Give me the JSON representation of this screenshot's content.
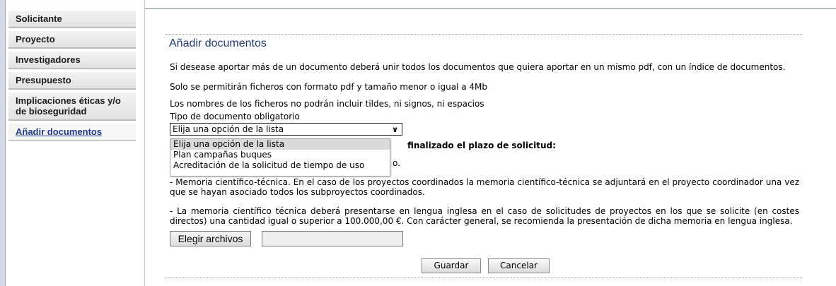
{
  "sidebar": {
    "items": [
      {
        "label": "Solicitante"
      },
      {
        "label": "Proyecto"
      },
      {
        "label": "Investigadores"
      },
      {
        "label": "Presupuesto"
      },
      {
        "label": "Implicaciones éticas y/o de bioseguridad"
      },
      {
        "label": "Añadir documentos"
      }
    ]
  },
  "main": {
    "title": "Añadir documentos",
    "para1": "Si desease aportar más de un documento deberá unir todos los documentos que quiera aportar en un mismo pdf, con un índice de documentos.",
    "para2": "Solo se permitirán ficheros con formato pdf y tamaño menor o igual a 4Mb",
    "para3": "Los nombres de los ficheros no podrán incluir tildes, ni signos, ni espacios",
    "select_label": "Tipo de documento obligatorio",
    "select_value": "Elija una opción de la lista",
    "options": [
      "Elija una opción de la lista",
      "Plan campañas buques",
      "Acreditación de la solicitud de tiempo de uso"
    ],
    "partial_heading": "finalizado el plazo de solicitud:",
    "partial_suffix": "o.",
    "para_memoria": "- Memoria científico-técnica. En el caso de los proyectos coordinados la memoria científico-técnica se adjuntará en el proyecto coordinador una vez que se hayan asociado todos los subproyectos coordinados.",
    "para_ingles": "- La memoria científico técnica deberá presentarse en lengua inglesa en el caso de solicitudes de proyectos en los que se solicite (en costes directos) una cantidad igual o superior a 100.000,00 €. Con carácter general, se recomienda la presentación de dicha memoria en lengua inglesa.",
    "file_button": "Elegir archivos",
    "save_button": "Guardar",
    "cancel_button": "Cancelar"
  },
  "colors": {
    "title": "#1f3a7a",
    "active_nav": "#1f3a93"
  }
}
